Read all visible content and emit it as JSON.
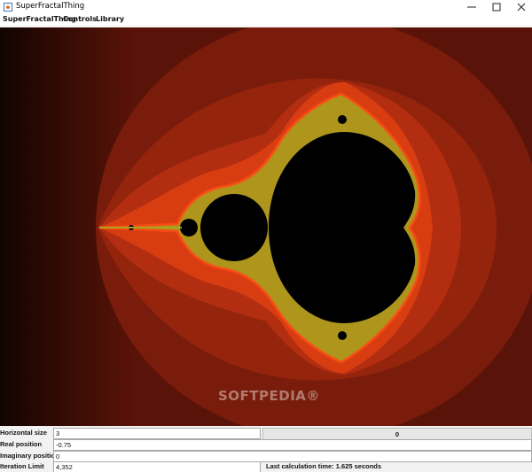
{
  "window": {
    "title": "SuperFractalThing",
    "icon": "java-coffee-icon",
    "buttons": {
      "minimize": "minimize-icon",
      "maximize": "maximize-icon",
      "close": "close-icon"
    }
  },
  "menu": {
    "items": [
      "SuperFractalThing",
      "Controls",
      "Library"
    ]
  },
  "fractal": {
    "description_icon": "mandelbrot-set",
    "colors": {
      "background_outer": "#5a1308",
      "background_left": "#1e0703",
      "band_1": "#7a1c0b",
      "band_2": "#95240d",
      "band_3": "#b32e10",
      "band_4": "#d83d12",
      "edge": "#ff4a14",
      "filament": "#a7a620",
      "set": "#000000"
    }
  },
  "watermark": "SOFTPEDIA®",
  "controls": {
    "horizontal_size": {
      "label": "Horizontal size",
      "value": "3"
    },
    "zoom_button": {
      "label": "0"
    },
    "real_position": {
      "label": "Real position",
      "value": "-0.75"
    },
    "imaginary_position": {
      "label": "Imaginary position",
      "value": "0"
    },
    "iteration_limit": {
      "label": "Iteration Limit",
      "value": "4,352"
    },
    "status": "Last calculation time: 1.625 seconds"
  }
}
